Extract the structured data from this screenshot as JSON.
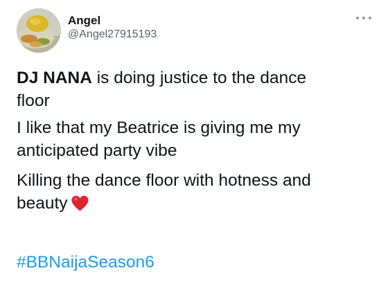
{
  "author": {
    "display_name": "Angel",
    "handle": "@Angel27915193"
  },
  "tweet": {
    "p1_bold": "DJ NANA",
    "p1_line1_rest": " is doing justice to the dance",
    "p1_line2": "floor",
    "p2_line1": "I like that my Beatrice is giving me my",
    "p2_line2": "anticipated party vibe",
    "p3_line1": "Killing the dance floor with hotness and",
    "p3_line2": "beauty",
    "hashtag": "#BBNaijaSeason6"
  },
  "icons": {
    "more": "more-options-icon",
    "heart": "red-heart-emoji"
  },
  "colors": {
    "text": "#0f1419",
    "secondary": "#536471",
    "link": "#1d9bf0",
    "heart": "#e0242f"
  }
}
